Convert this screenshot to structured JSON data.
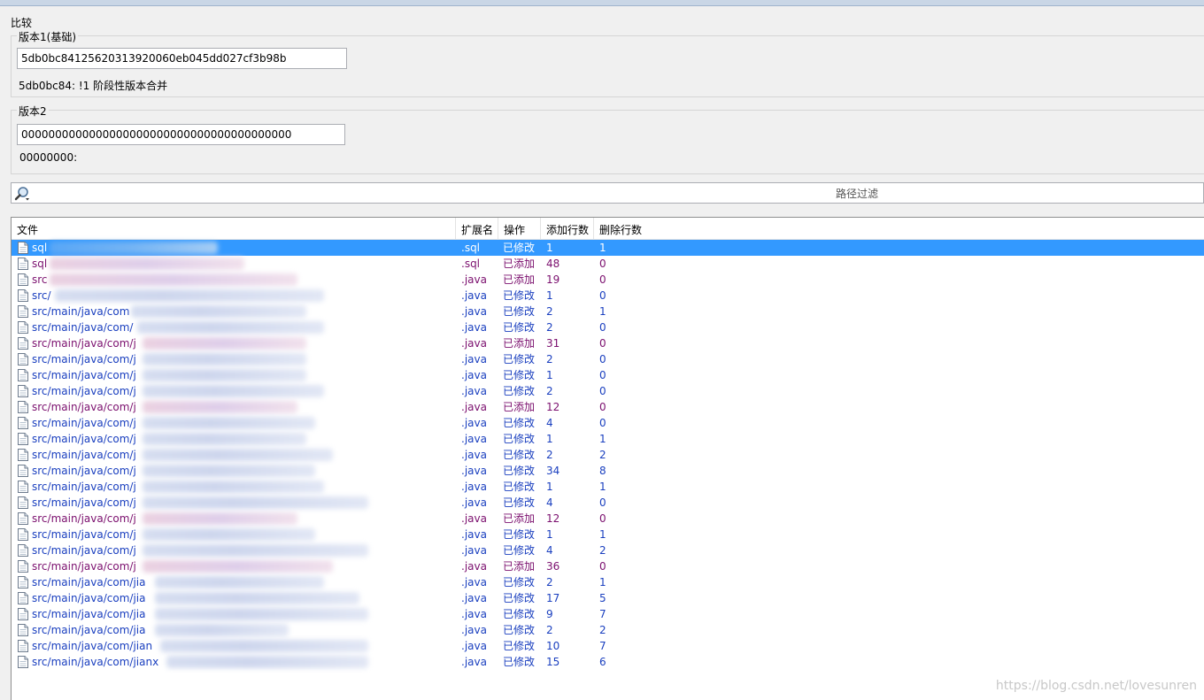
{
  "compare": {
    "title": "比较",
    "version1": {
      "legend": "版本1(基础)",
      "hash": "5db0bc84125620313920060eb045dd027cf3b98b",
      "info": "5db0bc84: !1 阶段性版本合并"
    },
    "version2": {
      "legend": "版本2",
      "hash": "0000000000000000000000000000000000000000",
      "info": "00000000:"
    }
  },
  "filter": {
    "placeholder": "路径过滤",
    "icon": "search-icon"
  },
  "list": {
    "columns": [
      "文件",
      "扩展名",
      "操作",
      "添加行数",
      "删除行数"
    ],
    "rows": [
      {
        "path": "sql",
        "ext": ".sql",
        "op": "已修改",
        "added": "1",
        "deleted": "1",
        "kind": "mod",
        "selected": true
      },
      {
        "path": "sql",
        "ext": ".sql",
        "op": "已添加",
        "added": "48",
        "deleted": "0",
        "kind": "new"
      },
      {
        "path": "src",
        "ext": ".java",
        "op": "已添加",
        "added": "19",
        "deleted": "0",
        "kind": "new"
      },
      {
        "path": "src/",
        "ext": ".java",
        "op": "已修改",
        "added": "1",
        "deleted": "0",
        "kind": "mod"
      },
      {
        "path": "src/main/java/com",
        "ext": ".java",
        "op": "已修改",
        "added": "2",
        "deleted": "1",
        "kind": "mod"
      },
      {
        "path": "src/main/java/com/",
        "ext": ".java",
        "op": "已修改",
        "added": "2",
        "deleted": "0",
        "kind": "mod"
      },
      {
        "path": "src/main/java/com/j",
        "ext": ".java",
        "op": "已添加",
        "added": "31",
        "deleted": "0",
        "kind": "new"
      },
      {
        "path": "src/main/java/com/j",
        "ext": ".java",
        "op": "已修改",
        "added": "2",
        "deleted": "0",
        "kind": "mod"
      },
      {
        "path": "src/main/java/com/j",
        "ext": ".java",
        "op": "已修改",
        "added": "1",
        "deleted": "0",
        "kind": "mod"
      },
      {
        "path": "src/main/java/com/j",
        "ext": ".java",
        "op": "已修改",
        "added": "2",
        "deleted": "0",
        "kind": "mod"
      },
      {
        "path": "src/main/java/com/j",
        "ext": ".java",
        "op": "已添加",
        "added": "12",
        "deleted": "0",
        "kind": "new"
      },
      {
        "path": "src/main/java/com/j",
        "ext": ".java",
        "op": "已修改",
        "added": "4",
        "deleted": "0",
        "kind": "mod"
      },
      {
        "path": "src/main/java/com/j",
        "ext": ".java",
        "op": "已修改",
        "added": "1",
        "deleted": "1",
        "kind": "mod"
      },
      {
        "path": "src/main/java/com/j",
        "ext": ".java",
        "op": "已修改",
        "added": "2",
        "deleted": "2",
        "kind": "mod"
      },
      {
        "path": "src/main/java/com/j",
        "ext": ".java",
        "op": "已修改",
        "added": "34",
        "deleted": "8",
        "kind": "mod"
      },
      {
        "path": "src/main/java/com/j",
        "ext": ".java",
        "op": "已修改",
        "added": "1",
        "deleted": "1",
        "kind": "mod"
      },
      {
        "path": "src/main/java/com/j",
        "ext": ".java",
        "op": "已修改",
        "added": "4",
        "deleted": "0",
        "kind": "mod"
      },
      {
        "path": "src/main/java/com/j",
        "ext": ".java",
        "op": "已添加",
        "added": "12",
        "deleted": "0",
        "kind": "new"
      },
      {
        "path": "src/main/java/com/j",
        "ext": ".java",
        "op": "已修改",
        "added": "1",
        "deleted": "1",
        "kind": "mod"
      },
      {
        "path": "src/main/java/com/j",
        "ext": ".java",
        "op": "已修改",
        "added": "4",
        "deleted": "2",
        "kind": "mod"
      },
      {
        "path": "src/main/java/com/j",
        "ext": ".java",
        "op": "已添加",
        "added": "36",
        "deleted": "0",
        "kind": "new"
      },
      {
        "path": "src/main/java/com/jia",
        "ext": ".java",
        "op": "已修改",
        "added": "2",
        "deleted": "1",
        "kind": "mod"
      },
      {
        "path": "src/main/java/com/jia",
        "ext": ".java",
        "op": "已修改",
        "added": "17",
        "deleted": "5",
        "kind": "mod"
      },
      {
        "path": "src/main/java/com/jia",
        "ext": ".java",
        "op": "已修改",
        "added": "9",
        "deleted": "7",
        "kind": "mod"
      },
      {
        "path": "src/main/java/com/jia",
        "ext": ".java",
        "op": "已修改",
        "added": "2",
        "deleted": "2",
        "kind": "mod"
      },
      {
        "path": "src/main/java/com/jian",
        "ext": ".java",
        "op": "已修改",
        "added": "10",
        "deleted": "7",
        "kind": "mod"
      },
      {
        "path": "src/main/java/com/jianx",
        "ext": ".java",
        "op": "已修改",
        "added": "15",
        "deleted": "6",
        "kind": "mod"
      }
    ]
  },
  "watermark": "https://blog.csdn.net/lovesunren",
  "colors": {
    "modified": "#1a3fbf",
    "added": "#7b0f6e",
    "selection": "#3399ff"
  }
}
